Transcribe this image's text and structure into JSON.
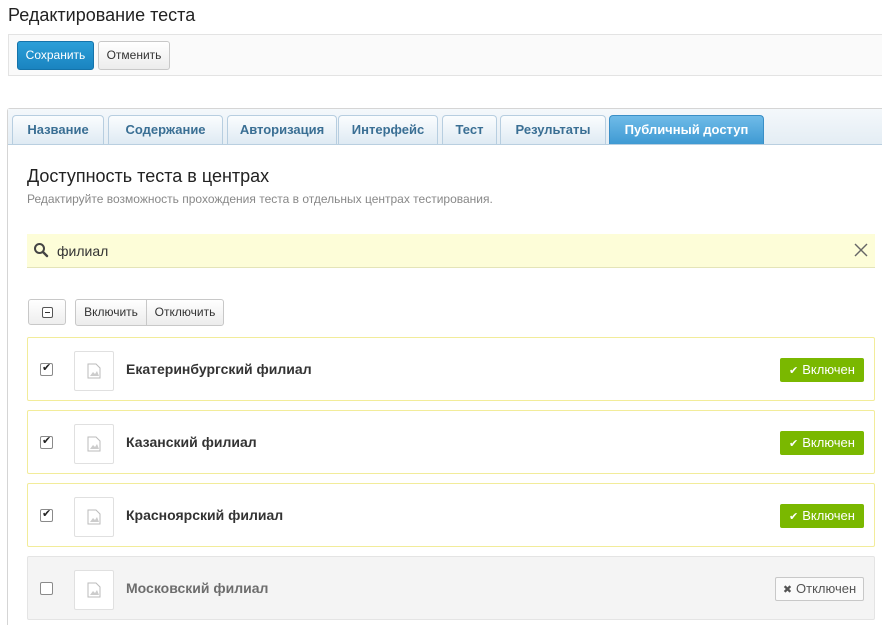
{
  "page": {
    "title": "Редактирование теста"
  },
  "toolbar": {
    "save_label": "Сохранить",
    "cancel_label": "Отменить"
  },
  "tabs": [
    {
      "label": "Название",
      "active": false
    },
    {
      "label": "Содержание",
      "active": false
    },
    {
      "label": "Авторизация",
      "active": false
    },
    {
      "label": "Интерфейс",
      "active": false
    },
    {
      "label": "Тест",
      "active": false
    },
    {
      "label": "Результаты",
      "active": false
    },
    {
      "label": "Публичный доступ",
      "active": true
    }
  ],
  "section": {
    "title": "Доступность теста в центрах",
    "subtitle": "Редактируйте возможность прохождения теста в отдельных центрах тестирования."
  },
  "search": {
    "value": "филиал",
    "icon": "search-icon",
    "clear_icon": "close-icon"
  },
  "bulk": {
    "enable_label": "Включить",
    "disable_label": "Отключить"
  },
  "centers": [
    {
      "name": "Екатеринбургский филиал",
      "checked": true,
      "status": "Включен",
      "enabled": true
    },
    {
      "name": "Казанский филиал",
      "checked": true,
      "status": "Включен",
      "enabled": true
    },
    {
      "name": "Красноярский филиал",
      "checked": true,
      "status": "Включен",
      "enabled": true
    },
    {
      "name": "Московский филиал",
      "checked": false,
      "status": "Отключен",
      "enabled": false
    }
  ],
  "colors": {
    "accent": "#1a84c0",
    "enabled_badge": "#7ab800",
    "row_highlight": "#f2ec9a",
    "search_bg": "#fdfdd8"
  }
}
